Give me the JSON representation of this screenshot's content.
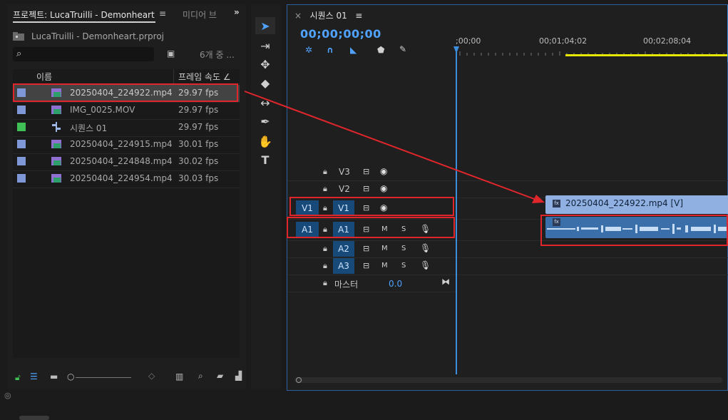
{
  "project": {
    "tab_active": "프로젝트: LucaTruilli - Demonheart",
    "tab_menu_icon": "menu-icon",
    "tab_other": "미디어 브",
    "more_icon": "»",
    "project_file": "LucaTruilli - Demonheart.prproj",
    "item_count": "6개 중 ...",
    "header_name": "이름",
    "header_rate": "프레임 속도 ∠",
    "items": [
      {
        "name": "20250404_224922.mp4",
        "rate": "29.97 fps",
        "type": "video",
        "color": "#7f97d6",
        "selected": true
      },
      {
        "name": "IMG_0025.MOV",
        "rate": "29.97 fps",
        "type": "video",
        "color": "#7f97d6",
        "selected": false
      },
      {
        "name": "시퀀스 01",
        "rate": "29.97 fps",
        "type": "sequence",
        "color": "#3fbf55",
        "selected": false
      },
      {
        "name": "20250404_224915.mp4",
        "rate": "30.01 fps",
        "type": "video",
        "color": "#7f97d6",
        "selected": false
      },
      {
        "name": "20250404_224848.mp4",
        "rate": "30.02 fps",
        "type": "video",
        "color": "#7f97d6",
        "selected": false
      },
      {
        "name": "20250404_224954.mp4",
        "rate": "30.03 fps",
        "type": "video",
        "color": "#7f97d6",
        "selected": false
      }
    ]
  },
  "tools": [
    "selection-tool",
    "track-select-tool",
    "ripple-edit-tool",
    "razor-tool",
    "slip-tool",
    "pen-tool",
    "hand-tool",
    "type-tool"
  ],
  "timeline": {
    "close": "×",
    "tab": "시퀀스 01",
    "menu": "≡",
    "timecode": "00;00;00;00",
    "ruler": [
      ";00;00",
      "00;01;04;02",
      "00;02;08;04"
    ],
    "tracks": {
      "v3": "V3",
      "v2": "V2",
      "v1": "V1",
      "a1": "A1",
      "a2": "A2",
      "a3": "A3",
      "src_v1": "V1",
      "src_a1": "A1",
      "master": "마스터",
      "master_value": "0.0"
    },
    "m": "M",
    "s": "S",
    "clip_video": "20250404_224922.mp4 [V]"
  },
  "colors": {
    "accent": "#3c8dde",
    "annotation": "#e0262b",
    "clip_video": "#8fb0e0",
    "clip_audio": "#3b6fa9"
  }
}
